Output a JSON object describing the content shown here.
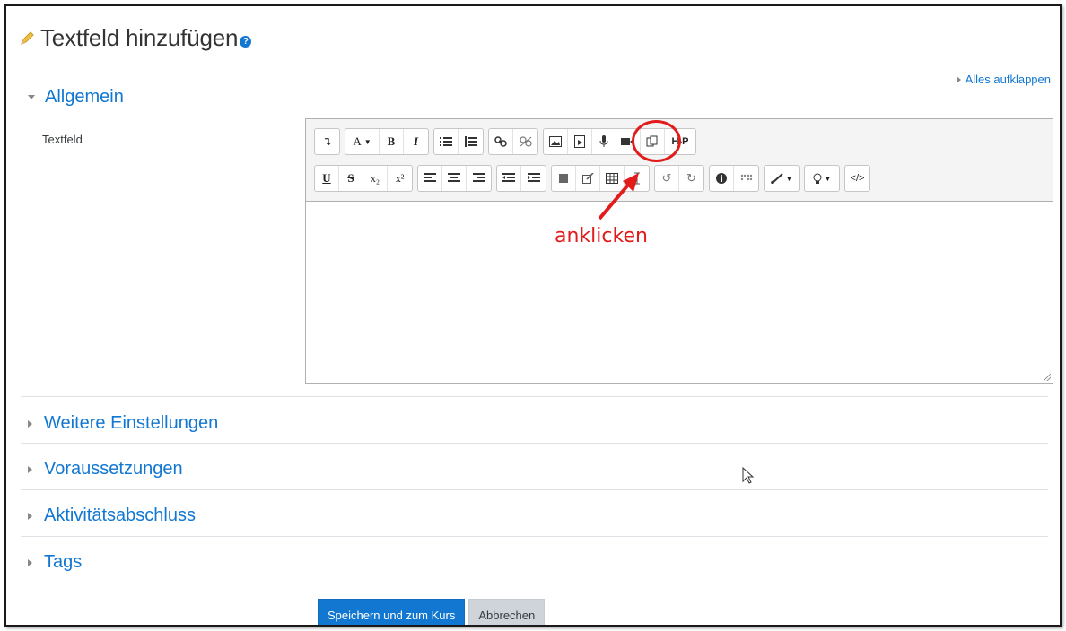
{
  "header": {
    "title": "Textfeld hinzufügen",
    "help_icon": "question-icon",
    "title_icon": "pencil-icon"
  },
  "expand_all": "Alles aufklappen",
  "sections": {
    "general": "Allgemein",
    "more_settings": "Weitere Einstellungen",
    "prerequisites": "Voraussetzungen",
    "completion": "Aktivitätsabschluss",
    "tags": "Tags"
  },
  "field": {
    "label": "Textfeld",
    "content": ""
  },
  "toolbar": {
    "row1": {
      "collapse": "↴",
      "font_style": "A",
      "bold": "B",
      "italic": "I",
      "bullets": "≡",
      "numbering": "≡",
      "link": "%",
      "unlink": "S",
      "image": "image-icon",
      "media": "file-media-icon",
      "record_audio": "microphone-icon",
      "record_video": "camera-icon",
      "manage_files": "files-icon",
      "h5p": "H-P"
    },
    "row2": {
      "underline": "U",
      "strikethrough": "S",
      "subscript": "x₂",
      "superscript": "x²",
      "undo": "↺",
      "redo": "↻"
    }
  },
  "annotation": {
    "text": "anklicken",
    "color": "#e21b1b"
  },
  "actions": {
    "save": "Speichern und zum Kurs",
    "cancel": "Abbrechen"
  },
  "colors": {
    "link": "#1177d1",
    "primary_button": "#1177d1",
    "secondary_button": "#ced4da"
  }
}
